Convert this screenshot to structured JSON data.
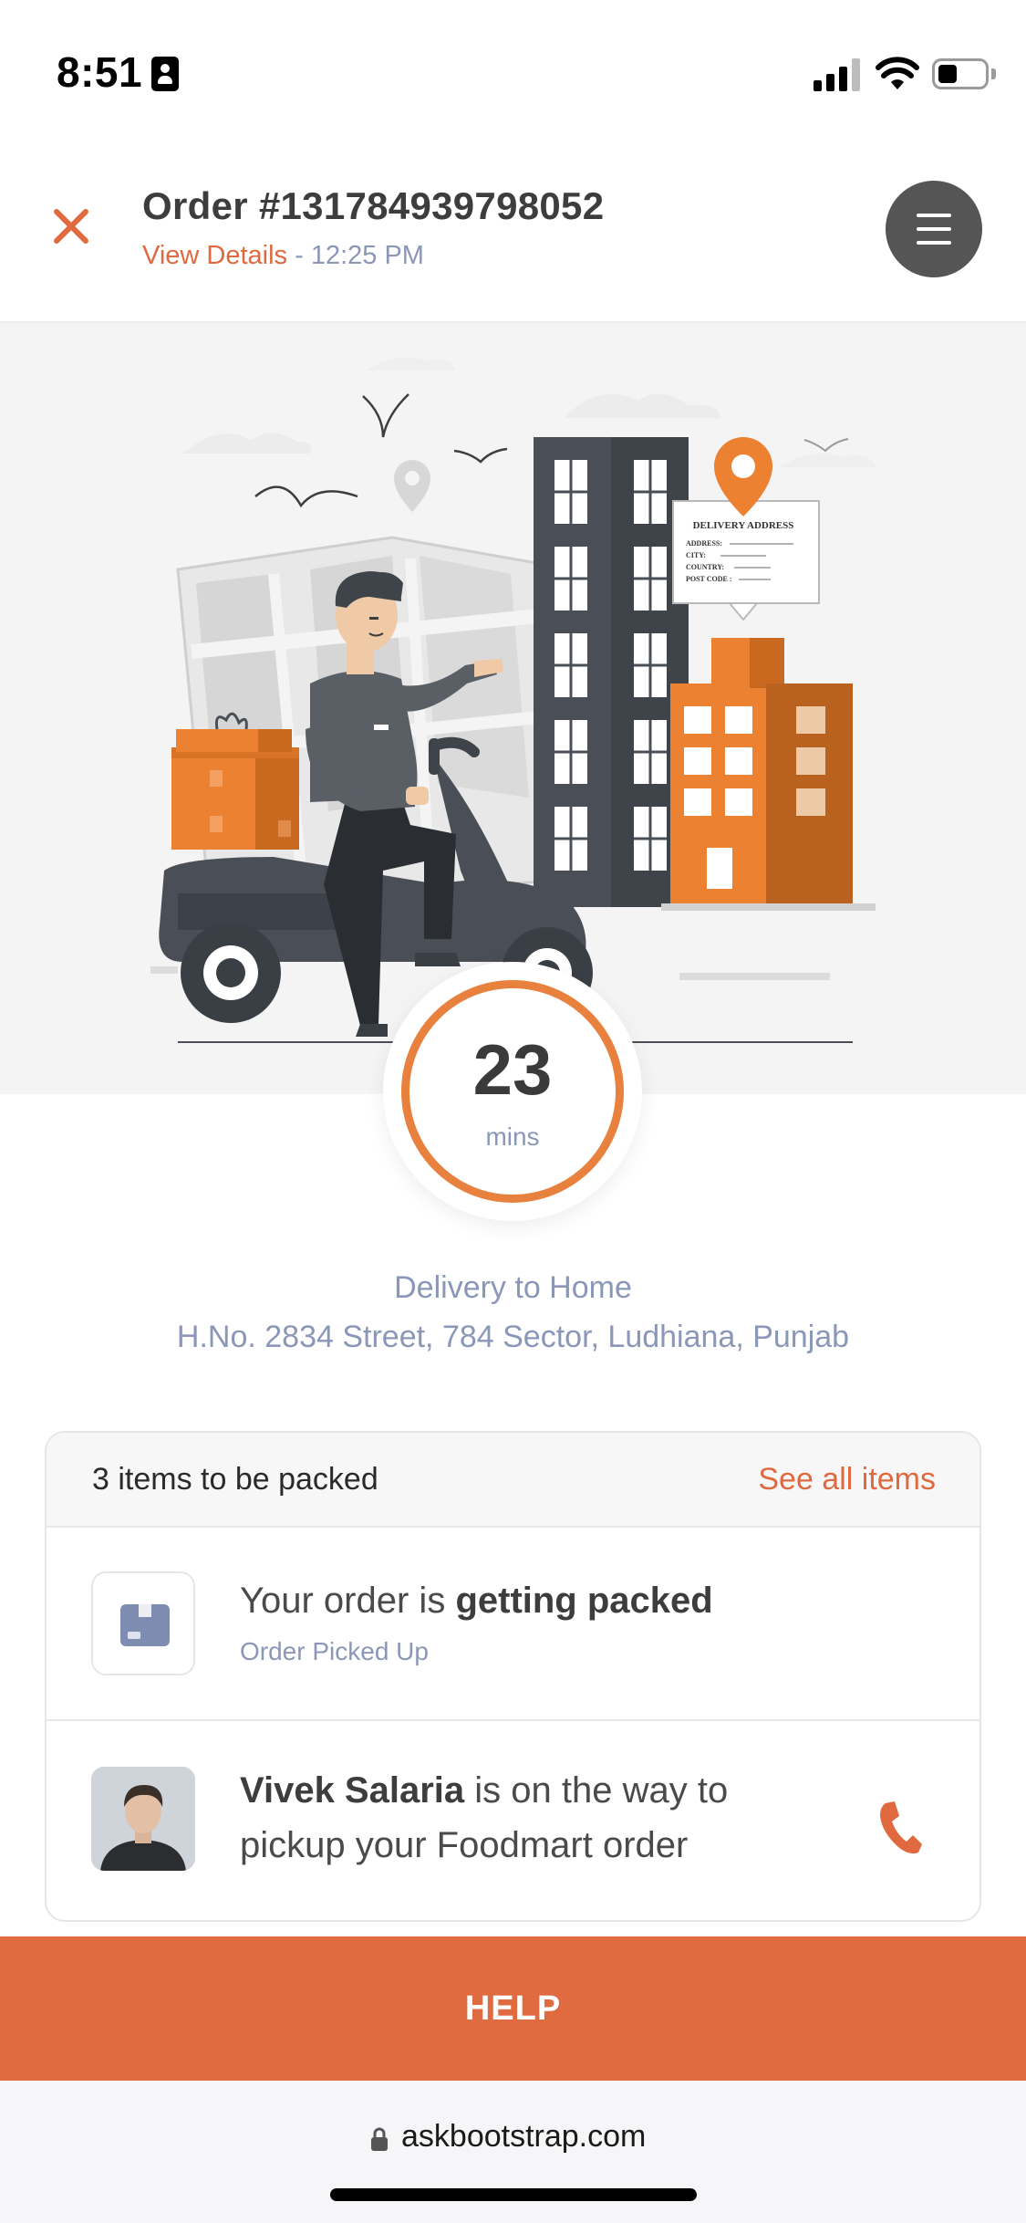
{
  "status_bar": {
    "time": "8:51",
    "icons": [
      "id-card-icon",
      "cellular-signal-icon",
      "wifi-icon",
      "battery-icon"
    ]
  },
  "header": {
    "order_title": "Order #131784939798052",
    "view_details_label": "View Details",
    "separator": " - ",
    "time": "12:25 PM",
    "icons": [
      "close-icon",
      "hamburger-menu-icon"
    ]
  },
  "illustration": {
    "sign_title": "DELIVERY ADDRESS",
    "sign_lines": [
      "ADDRESS:",
      "CITY:",
      "COUNTRY:",
      "POST CODE :"
    ]
  },
  "timer": {
    "value": "23",
    "unit": "mins"
  },
  "delivery": {
    "label": "Delivery to Home",
    "address": "H.No. 2834 Street, 784 Sector, Ludhiana, Punjab"
  },
  "order_card": {
    "items_count_label": "3 items to be packed",
    "see_all_label": "See all items",
    "packing": {
      "status_prefix": "Your order is ",
      "status_bold": "getting packed",
      "substatus": "Order Picked Up"
    },
    "rider": {
      "name": "Vivek Salaria",
      "message": " is on the way to pickup your Foodmart order"
    }
  },
  "help_button": {
    "label": "HELP"
  },
  "browser": {
    "url": "askbootstrap.com"
  },
  "colors": {
    "accent": "#e0693f",
    "timer_ring": "#e8813d",
    "muted_text": "#8b97b8",
    "help_bg": "#e06b40"
  }
}
